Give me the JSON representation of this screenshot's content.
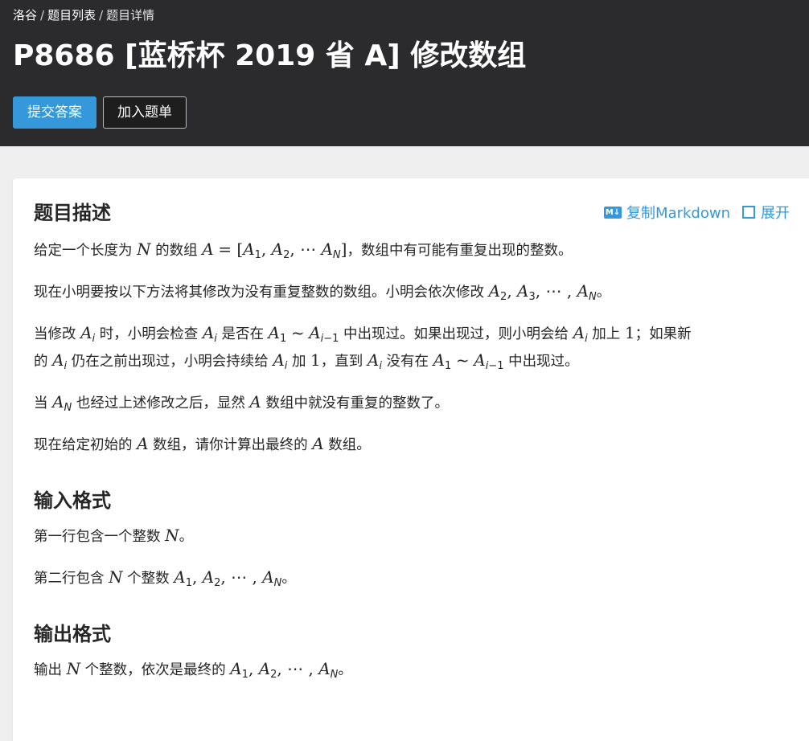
{
  "breadcrumb": [
    "洛谷",
    "题目列表",
    "题目详情"
  ],
  "breadcrumb_sep": "/",
  "title": "P8686 [蓝桥杯 2019 省 A] 修改数组",
  "buttons": {
    "submit": "提交答案",
    "add_list": "加入题单"
  },
  "tools": {
    "md_badge": "M↓",
    "copy_markdown": "复制Markdown",
    "expand": "展开"
  },
  "sections": {
    "description": {
      "title": "题目描述",
      "p1_a": "给定一个长度为",
      "p1_b": "的数组",
      "p1_c": "，数组中有可能有重复出现的整数。",
      "p2_a": "现在小明要按以下方法将其修改为没有重复整数的数组。小明会依次修改",
      "p2_b": "。",
      "p3_a": "当修改",
      "p3_b": "时，小明会检查",
      "p3_c": "是否在",
      "p3_d": "中出现过。如果出现过，则小明会给",
      "p3_e": "加上",
      "p3_f": "；如果新",
      "p3_g": "的",
      "p3_h": "仍在之前出现过，小明会持续给",
      "p3_i": "加",
      "p3_j": "，直到",
      "p3_k": "没有在",
      "p3_l": "中出现过。",
      "p4_a": "当",
      "p4_b": "也经过上述修改之后，显然",
      "p4_c": "数组中就没有重复的整数了。",
      "p5_a": "现在给定初始的",
      "p5_b": "数组，请你计算出最终的",
      "p5_c": "数组。"
    },
    "input": {
      "title": "输入格式",
      "l1_a": "第一行包含一个整数",
      "l1_b": "。",
      "l2_a": "第二行包含",
      "l2_b": "个整数",
      "l2_c": "。"
    },
    "output": {
      "title": "输出格式",
      "l1_a": "输出",
      "l1_b": "个整数，依次是最终的",
      "l1_c": "。"
    }
  },
  "colors": {
    "header_bg": "#2b2b2d",
    "accent": "#3498db",
    "page_bg": "#efefef"
  }
}
